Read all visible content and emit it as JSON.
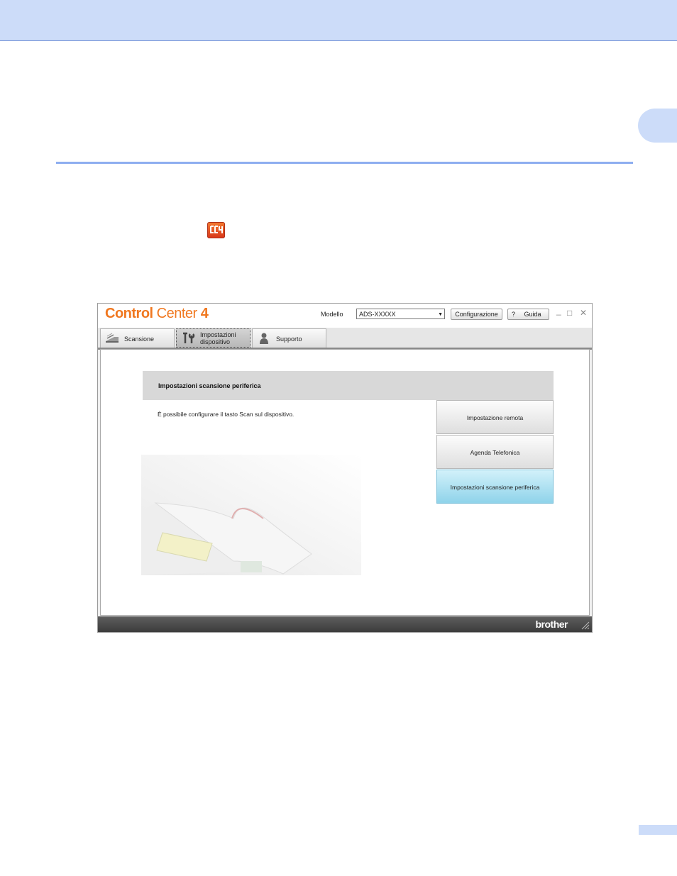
{
  "app": {
    "logo": {
      "bold": "Control",
      "light": "Center",
      "suffix": "4"
    },
    "model_label": "Modello",
    "model_value": "ADS-XXXXX",
    "buttons": {
      "config": "Configurazione",
      "help_mark": "?",
      "help": "Guida"
    },
    "window_controls": {
      "minimize": "_",
      "maximize": "□",
      "close": "✕"
    }
  },
  "tabs": [
    {
      "label": "Scansione",
      "icon": "scan-icon"
    },
    {
      "label": "Impostazioni dispositivo",
      "icon": "device-settings-icon"
    },
    {
      "label": "Supporto",
      "icon": "support-person-icon"
    }
  ],
  "content": {
    "panel_title": "Impostazioni scansione periferica",
    "description": "È possibile configurare il tasto Scan sul dispositivo.",
    "side_buttons": [
      {
        "label": "Impostazione remota"
      },
      {
        "label": "Agenda Telefonica"
      },
      {
        "label": "Impostazioni scansione periferica"
      }
    ]
  },
  "footer": {
    "brand": "brother"
  },
  "colors": {
    "header_band": "#ccdcf9",
    "rule": "#8eaef0",
    "logo": "#f07820",
    "selected_button": "#a8def0"
  }
}
